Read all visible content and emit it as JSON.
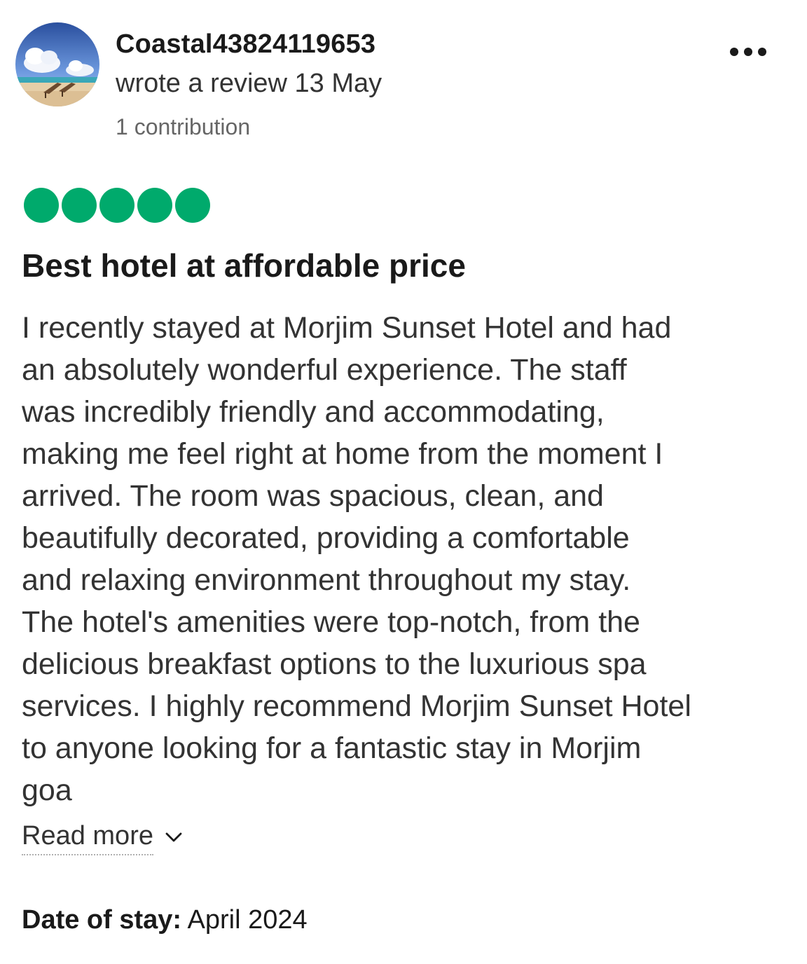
{
  "review": {
    "username": "Coastal43824119653",
    "wrote_line": "wrote a review 13 May",
    "contributions": "1 contribution",
    "avatar_icon": "beach-photo",
    "more_icon": "more-options-icon",
    "rating": {
      "value": 5,
      "max": 5,
      "color": "#00aa6c"
    },
    "title": "Best hotel at affordable price",
    "body_lines": [
      "I recently stayed at Morjim Sunset Hotel and had",
      "an absolutely wonderful experience. The staff",
      "was incredibly friendly and accommodating,",
      "making me feel right at home from the moment I",
      "arrived. The room was spacious, clean, and",
      "beautifully decorated, providing a comfortable",
      "and relaxing environment throughout my stay.",
      "The hotel's amenities were top-notch, from the",
      "delicious breakfast options to the luxurious spa",
      "services. I highly recommend Morjim Sunset Hotel",
      "to anyone looking for a fantastic stay in Morjim",
      "goa"
    ],
    "read_more_label": "Read more",
    "read_more_icon": "chevron-down-icon",
    "date_of_stay_label": "Date of stay:",
    "date_of_stay_value": "April 2024"
  }
}
